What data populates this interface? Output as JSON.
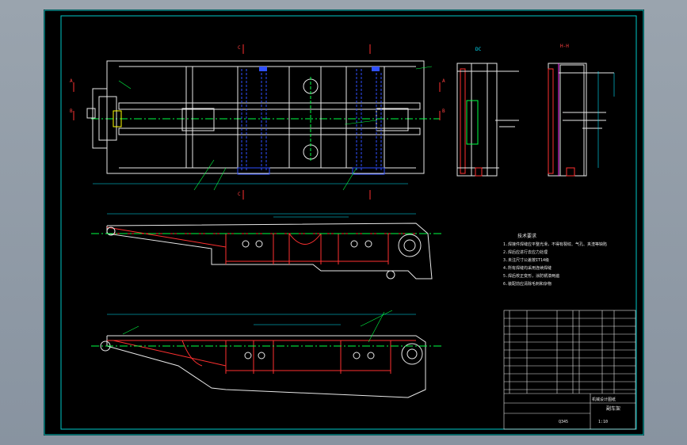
{
  "section_marks": {
    "c": "C",
    "b": "B",
    "a": "A"
  },
  "detail_labels": {
    "dc": "DC",
    "bb": "B-B",
    "hh": "H-H",
    "bb2": "B-B"
  },
  "notes": {
    "title": "技术要求",
    "lines": [
      "1.焊接件焊缝应平整光滑，不得有裂纹、气孔、夹渣等缺陷",
      "2.焊后应进行去应力处理",
      "3.未注尺寸公差按IT14级",
      "4.所有焊缝均采用连续焊缝",
      "5.焊后校正变形，涂防锈漆两遍",
      "6.装配前应清除毛刺和杂物"
    ]
  },
  "title_block": {
    "drawing_name": "副车架",
    "company": "机械设计图纸",
    "scale": "1:10",
    "material": "Q345"
  },
  "colors": {
    "frame_line": "#e8e8e8",
    "weld_red": "#ff3030",
    "dim_cyan": "#00e5ff",
    "green": "#00ff44",
    "blue": "#3050ff",
    "yellow": "#ffff00",
    "magenta": "#ff30ff",
    "border_cyan": "#00c8c8"
  }
}
